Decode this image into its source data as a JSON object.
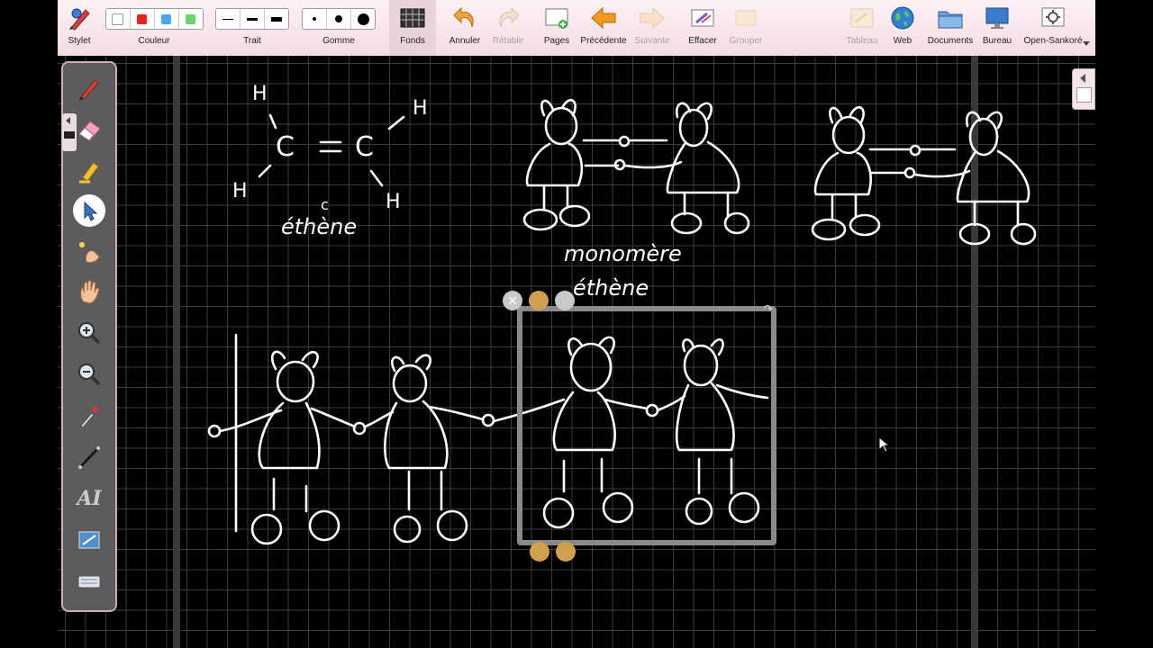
{
  "toolbar": {
    "stylet": "Stylet",
    "couleur": "Couleur",
    "trait": "Trait",
    "gomme": "Gomme",
    "fonds": "Fonds",
    "annuler": "Annuler",
    "retablir": "Rétablir",
    "pages": "Pages",
    "precedente": "Précédente",
    "suivante": "Suivante",
    "effacer": "Effacer",
    "grouper": "Grouper",
    "tableau": "Tableau",
    "web": "Web",
    "documents": "Documents",
    "bureau": "Bureau",
    "open_sankore": "Open-Sankoré"
  },
  "colors": {
    "swatches": [
      "#ffffff",
      "#e8231c",
      "#4aa6f0",
      "#6bd36b"
    ],
    "toolbar_bg": "#f6e3e7",
    "board_bg": "#000000",
    "grid": "#3c3c3c",
    "ink": "#ffffff"
  },
  "palette_icons": [
    "pen-icon",
    "eraser-icon",
    "highlighter-icon",
    "pointer-icon",
    "laser-pointer-icon",
    "hand-icon",
    "zoom-in-icon",
    "zoom-out-icon",
    "eyedropper-icon",
    "line-icon",
    "text-icon",
    "capture-icon",
    "keyboard-icon"
  ],
  "board": {
    "ethene_label": "éthène",
    "ethene_accent": "c",
    "atom_c": "C",
    "atom_h": "H",
    "monomere_label": "monomère",
    "ethene_label2": "éthène",
    "equals": "="
  }
}
